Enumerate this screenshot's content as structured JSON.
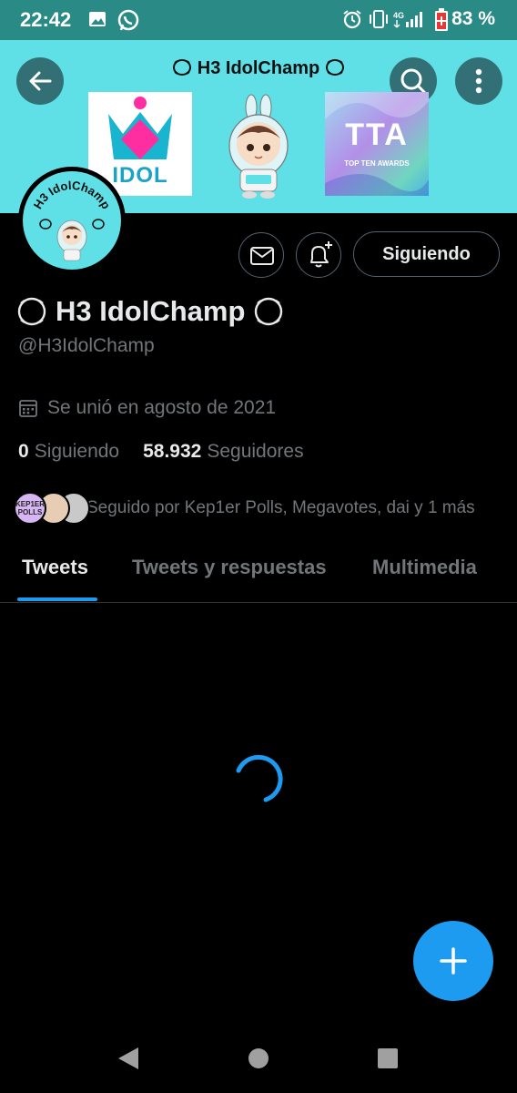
{
  "status_bar": {
    "time": "22:42",
    "battery_text": "83 %",
    "icons": [
      "image-icon",
      "whatsapp-icon",
      "alarm-icon",
      "vibrate-icon",
      "4g-icon",
      "signal-icon",
      "battery-icon"
    ]
  },
  "banner": {
    "title": "H3 IdolChamp",
    "idol_tile_text": "IDOL",
    "tta_tile_text": "TTA",
    "tta_tile_subtext": "TOP TEN AWARDS",
    "avatar_text": "H3 IdolChamp",
    "background_color": "#5ee0e6"
  },
  "actions": {
    "follow_label": "Siguiendo"
  },
  "profile": {
    "display_name": "H3 IdolChamp",
    "handle": "@H3IdolChamp",
    "joined": "Se unió en agosto de 2021",
    "following_count": "0",
    "following_label": "Siguiendo",
    "followers_count": "58.932",
    "followers_label": "Seguidores",
    "followed_by_text": "Seguido por Kep1er Polls, Megavotes, dai y 1 más",
    "mini_avatar_text": "KEP1ER POLLS"
  },
  "tabs": [
    {
      "label": "Tweets",
      "active": true
    },
    {
      "label": "Tweets y respuestas",
      "active": false
    },
    {
      "label": "Multimedia",
      "active": false
    }
  ],
  "colors": {
    "accent": "#1d9bf0",
    "status_bar": "#2a8a86",
    "secondary_text": "#71767b"
  }
}
